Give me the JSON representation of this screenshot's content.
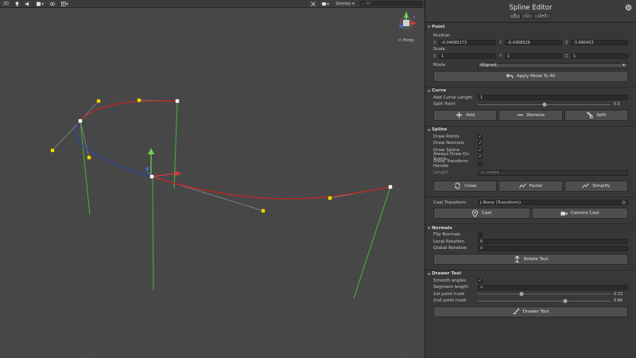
{
  "scene": {
    "toolbar": {
      "item_2d": "2D",
      "gizmos": "Gizmos",
      "search_placeholder": "All"
    },
    "persp": "< Persp"
  },
  "inspector": {
    "title": "Spline Editor",
    "tabs": [
      "T",
      "☐",
      "☐+T"
    ],
    "point": {
      "header": "Point",
      "position_label": "Position",
      "position": {
        "x": "-0.04095173",
        "y": "-0.4368526",
        "z": "-3.460433"
      },
      "scale_label": "Scale",
      "scale": {
        "x": "1",
        "y": "1",
        "z": "1"
      },
      "mode_label": "Mode",
      "mode_value": "Aligned",
      "apply_button": "Apply Mode To All"
    },
    "curve": {
      "header": "Curve",
      "add_length_label": "Add Curve Length",
      "add_length_value": "1",
      "split_point_label": "Split Point",
      "split_point_value": "0.5",
      "split_point_fraction": 0.5,
      "add_button": "Add",
      "remove_button": "Remove",
      "split_button": "Split"
    },
    "spline": {
      "header": "Spline",
      "draw_points": "Draw Points",
      "draw_normals": "Draw Normals",
      "draw_spline": "Draw Spline",
      "always_draw": "Always Draw On Scene",
      "show_handle": "Show Transform Handle",
      "checks": {
        "draw_points": true,
        "draw_normals": true,
        "draw_spline": true,
        "always_draw": true,
        "show_handle": false
      },
      "length_label": "Length",
      "length_value": "15.69088",
      "close_button": "Close",
      "factor_button": "Factor",
      "simplify_button": "Simplify"
    },
    "cast": {
      "label": "Cast Transform",
      "value": "J.None (Transform)",
      "cast_button": "Cast",
      "camera_cast_button": "Camera Cast"
    },
    "normals": {
      "header": "Normals",
      "flip_label": "Flip Normals",
      "flip_checked": false,
      "local_label": "Local Rotation",
      "local_value": "0",
      "global_label": "Global Rotation",
      "global_value": "0",
      "rotate_button": "Rotate Tool"
    },
    "drawer": {
      "header": "Drawer Tool",
      "smooth_label": "Smooth angles",
      "smooth_checked": true,
      "segment_label": "Segment length",
      "segment_value": "5",
      "hook1_label": "1st point hook",
      "hook1_value": "0.33",
      "hook1_fraction": 0.33,
      "hook2_label": "2nd point hook",
      "hook2_value": "0.66",
      "hook2_fraction": 0.66,
      "drawer_button": "Drawer Tool"
    }
  },
  "colors": {
    "spline_red": "#c8231f",
    "spline_blue": "#2845b0",
    "handle_yellow": "#f2d600",
    "normal_green": "#3fb83f",
    "scene_bg": "#474747"
  }
}
